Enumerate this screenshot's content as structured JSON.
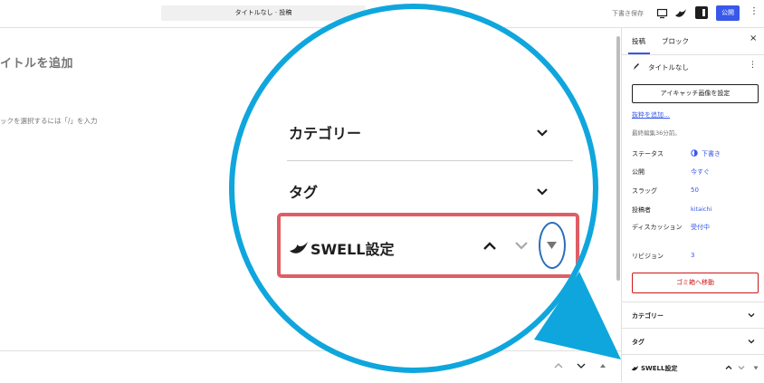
{
  "header": {
    "doc_title": "タイトルなし · 投稿",
    "save_draft": "下書き保存",
    "publish": "公開",
    "more": "⋮"
  },
  "editor": {
    "title_placeholder": "イトルを追加",
    "block_hint": "ックを選択するには「/」を入力"
  },
  "sidebar": {
    "tabs": [
      "投稿",
      "ブロック"
    ],
    "close": "×",
    "post_title": "タイトルなし",
    "featured_image_button": "アイキャッチ画像を設定",
    "excerpt_link": "抜粋を追加…",
    "last_edited": "最終編集36分前。",
    "rows": [
      {
        "label": "ステータス",
        "value": "下書き"
      },
      {
        "label": "公開",
        "value": "今すぐ"
      },
      {
        "label": "スラッグ",
        "value": "50"
      },
      {
        "label": "投稿者",
        "value": "kitaichi"
      },
      {
        "label": "ディスカッション",
        "value": "受付中"
      },
      {
        "label": "リビジョン",
        "value": "3"
      }
    ],
    "trash_button": "ゴミ箱へ移動",
    "panels": [
      "カテゴリー",
      "タグ",
      "SWELL設定"
    ]
  },
  "magnifier": {
    "category": "カテゴリー",
    "tag": "タグ",
    "swell": "SWELL設定"
  },
  "colors": {
    "accent": "#3858e9",
    "magnifier_ring": "#0fa6dd",
    "highlight": "#e05d65",
    "oval": "#2a6fba",
    "danger": "#cc1818"
  }
}
